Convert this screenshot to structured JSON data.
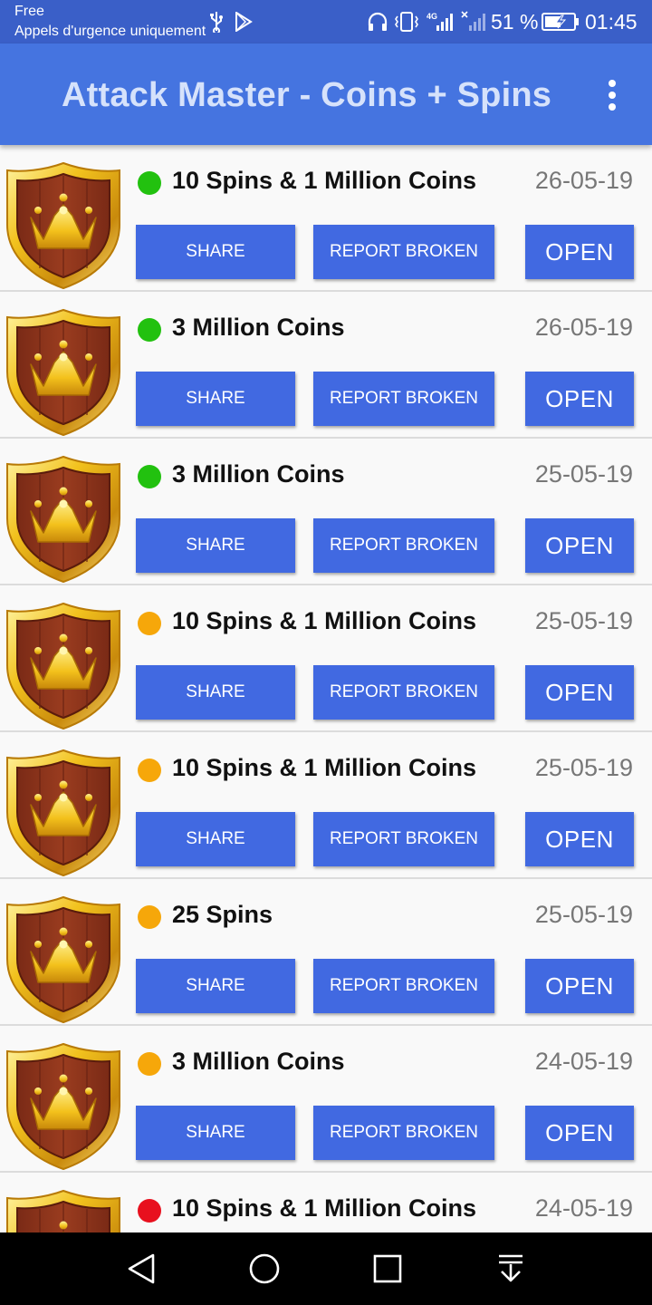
{
  "status_bar": {
    "carrier": "Free",
    "emergency_text": "Appels d'urgence uniquement",
    "battery_percent": "51 %",
    "time": "01:45",
    "network_label": "4G"
  },
  "app_bar": {
    "title": "Attack Master - Coins + Spins",
    "menu_icon": "more-vert-icon"
  },
  "list": {
    "items": [
      {
        "title": "10 Spins & 1 Million Coins",
        "date": "26-05-19",
        "status_color": "#22c10f"
      },
      {
        "title": "3 Million Coins",
        "date": "26-05-19",
        "status_color": "#22c10f"
      },
      {
        "title": "3 Million Coins",
        "date": "25-05-19",
        "status_color": "#22c10f"
      },
      {
        "title": "10 Spins & 1 Million Coins",
        "date": "25-05-19",
        "status_color": "#f6a70a"
      },
      {
        "title": "10 Spins & 1 Million Coins",
        "date": "25-05-19",
        "status_color": "#f6a70a"
      },
      {
        "title": "25 Spins",
        "date": "25-05-19",
        "status_color": "#f6a70a"
      },
      {
        "title": "3 Million Coins",
        "date": "24-05-19",
        "status_color": "#f6a70a"
      },
      {
        "title": "10 Spins & 1 Million Coins",
        "date": "24-05-19",
        "status_color": "#e8101e"
      }
    ],
    "share_label": "SHARE",
    "report_label": "REPORT BROKEN",
    "open_label": "OPEN"
  },
  "nav_bar": {
    "buttons": [
      "back-icon",
      "home-icon",
      "recents-icon",
      "notification-pull-icon"
    ]
  },
  "colors": {
    "status_bar": "#3a5fc8",
    "app_bar": "#4574e0",
    "button": "#4169e1",
    "green": "#22c10f",
    "orange": "#f6a70a",
    "red": "#e8101e"
  }
}
